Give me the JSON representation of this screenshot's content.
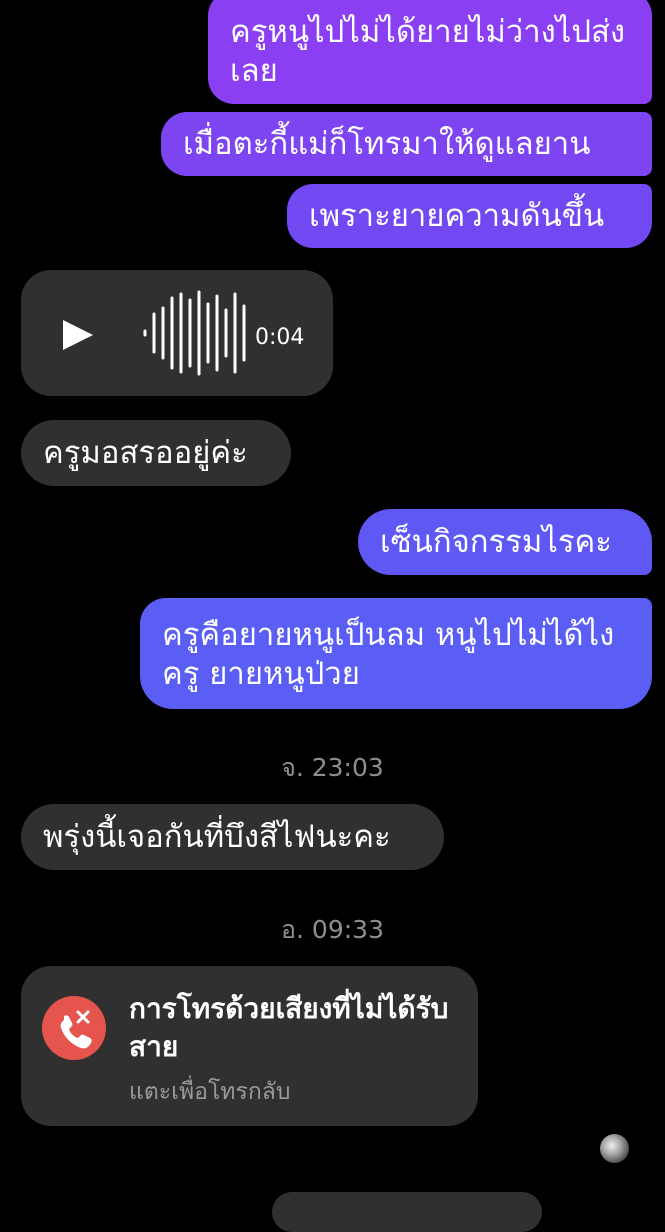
{
  "messages": {
    "m1": "ครูหนูไปไม่ได้ยายไม่ว่างไปส่งเลย",
    "m2": "เมื่อตะกี้แม่ก็โทรมาให้ดูแลยาน",
    "m3": "เพราะยายความดันขึ้น",
    "voice_duration": "0:04",
    "m4": "ครูมอสรออยู่ค่ะ",
    "m5": "เซ็นกิจกรรมไรคะ",
    "m6": "ครูคือยายหนูเป็นลม หนูไปไม่ได้ไงครู ยายหนูป่วย",
    "ts1": "จ. 23:03",
    "m7": "พรุ่งนี้เจอกันที่บึงสีไฟนะคะ",
    "ts2": "อ. 09:33"
  },
  "missed_call": {
    "title": "การโทรด้วยเสียงที่ไม่ได้รับสาย",
    "subtitle": "แตะเพื่อโทรกลับ"
  },
  "colors": {
    "background": "#000000",
    "incoming_bubble": "#303030",
    "outgoing_top": "#8a3ff3",
    "outgoing_bottom": "#5a5ef5",
    "missed_call_red": "#e5554d",
    "timestamp": "#8e8e93"
  },
  "icons": {
    "play": "play-icon",
    "waveform": "waveform-icon",
    "missed_call": "missed-call-icon",
    "avatar": "avatar"
  }
}
